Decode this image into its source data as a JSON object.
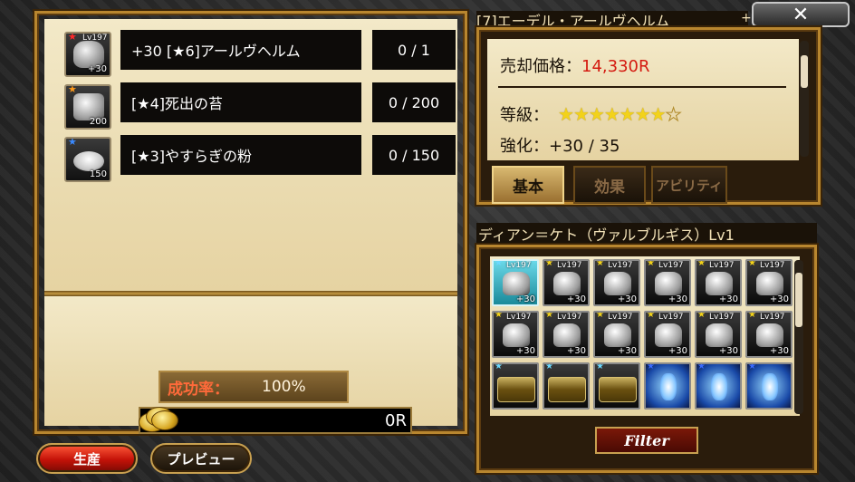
{
  "materials": [
    {
      "name": "+30 [★6]アールヴヘルム",
      "count": "0 / 1",
      "star_color": "#ff2a2a",
      "level": "Lv197",
      "qty": "+30",
      "icon": "helmet-icon"
    },
    {
      "name": "[★4]死出の苔",
      "count": "0 / 200",
      "star_color": "#ff9a1a",
      "level": "",
      "qty": "200",
      "icon": "moss-icon"
    },
    {
      "name": "[★3]やすらぎの粉",
      "count": "0 / 150",
      "star_color": "#3a8aff",
      "level": "",
      "qty": "150",
      "icon": "powder-icon"
    }
  ],
  "success": {
    "label": "成功率：",
    "value": "100%"
  },
  "cost": "0R",
  "buttons": {
    "produce": "生産",
    "preview": "プレビュー",
    "close": "✕",
    "filter": "Filter"
  },
  "detail": {
    "title": "[7]エーデル・アールヴヘルム",
    "title_suffix": "+",
    "price_label": "売却価格：",
    "price_value": "14,330R",
    "grade_label": "等級：",
    "grade_stars": 7,
    "grade_max": 8,
    "enhance": "強化：+30 / 35"
  },
  "tabs": [
    "基本",
    "効果",
    "アビリティ"
  ],
  "inventory": {
    "title": "ディアン＝ケト（ヴァルブルギス）Lv1",
    "slots": [
      {
        "type": "helmet",
        "star": "#6ad8ff",
        "lv": "Lv197",
        "plus": "+30",
        "selected": true,
        "icon": "helmet-icon"
      },
      {
        "type": "armor",
        "star": "#f2d21a",
        "lv": "Lv197",
        "plus": "+30",
        "icon": "armor-icon"
      },
      {
        "type": "leg",
        "star": "#f2d21a",
        "lv": "Lv197",
        "plus": "+30",
        "icon": "greaves-icon"
      },
      {
        "type": "helmet",
        "star": "#f2d21a",
        "lv": "Lv197",
        "plus": "+30",
        "icon": "helmet-icon"
      },
      {
        "type": "helmet",
        "star": "#f2d21a",
        "lv": "Lv197",
        "plus": "+30",
        "icon": "helmet-icon"
      },
      {
        "type": "armor",
        "star": "#f2d21a",
        "lv": "Lv197",
        "plus": "+30",
        "icon": "armor-icon"
      },
      {
        "type": "hat",
        "star": "#f2d21a",
        "lv": "Lv197",
        "plus": "+30",
        "icon": "hat-icon"
      },
      {
        "type": "armor",
        "star": "#f2d21a",
        "lv": "Lv197",
        "plus": "+30",
        "icon": "armor-icon"
      },
      {
        "type": "leg",
        "star": "#f2d21a",
        "lv": "Lv197",
        "plus": "+30",
        "icon": "greaves-icon"
      },
      {
        "type": "helmet",
        "star": "#f2d21a",
        "lv": "Lv197",
        "plus": "+30",
        "icon": "helmet-icon"
      },
      {
        "type": "helmet",
        "star": "#f2d21a",
        "lv": "Lv197",
        "plus": "+30",
        "icon": "helmet-icon"
      },
      {
        "type": "leg",
        "star": "#f2d21a",
        "lv": "Lv197",
        "plus": "+30",
        "icon": "greaves-icon"
      },
      {
        "type": "chest",
        "star": "#6ad8ff",
        "lv": "",
        "plus": "",
        "icon": "treasure-chest-icon"
      },
      {
        "type": "chest",
        "star": "#6ad8ff",
        "lv": "",
        "plus": "",
        "icon": "treasure-chest-icon"
      },
      {
        "type": "chest",
        "star": "#6ad8ff",
        "lv": "",
        "plus": "",
        "icon": "treasure-chest-icon"
      },
      {
        "type": "crystal",
        "star": "#3a6aff",
        "lv": "",
        "plus": "",
        "icon": "crystal-icon"
      },
      {
        "type": "crystal",
        "star": "#3a6aff",
        "lv": "",
        "plus": "",
        "icon": "crystal-icon"
      },
      {
        "type": "crystal",
        "star": "#3a6aff",
        "lv": "",
        "plus": "",
        "icon": "crystal-icon"
      }
    ]
  }
}
